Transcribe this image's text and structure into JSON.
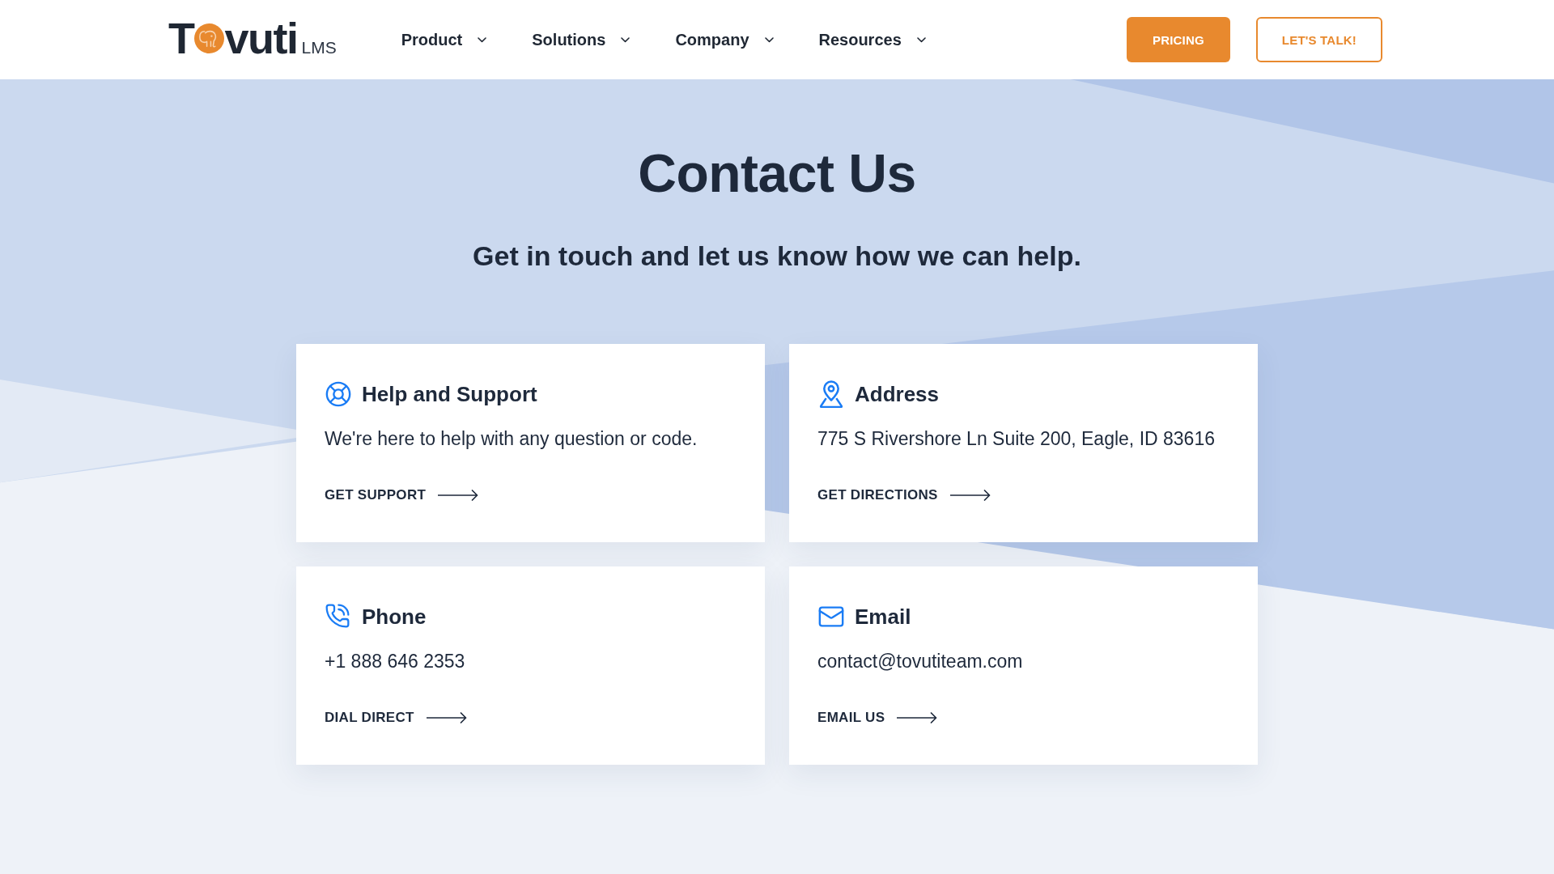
{
  "header": {
    "logo": {
      "lead": "T",
      "rest": "vuti",
      "suffix": "LMS"
    },
    "nav": [
      {
        "label": "Product"
      },
      {
        "label": "Solutions"
      },
      {
        "label": "Company"
      },
      {
        "label": "Resources"
      }
    ],
    "buttons": [
      {
        "label": "PRICING",
        "kind": "filled"
      },
      {
        "label": "LET'S TALK!",
        "kind": "outline"
      }
    ]
  },
  "hero": {
    "title": "Contact Us",
    "subtitle": "Get in touch and let us know how we can help."
  },
  "cards": [
    {
      "kind": "support",
      "title": "Help and Support",
      "text": "We're here to help with any question or code.",
      "link": "GET SUPPORT"
    },
    {
      "kind": "address",
      "title": "Address",
      "text": "775 S Rivershore Ln Suite 200, Eagle, ID 83616",
      "link": "GET DIRECTIONS"
    },
    {
      "kind": "phone",
      "title": "Phone",
      "text": "+1 888 646 2353",
      "link": "DIAL DIRECT"
    },
    {
      "kind": "email",
      "title": "Email",
      "text": "contact@tovutiteam.com",
      "link": "EMAIL US"
    }
  ]
}
